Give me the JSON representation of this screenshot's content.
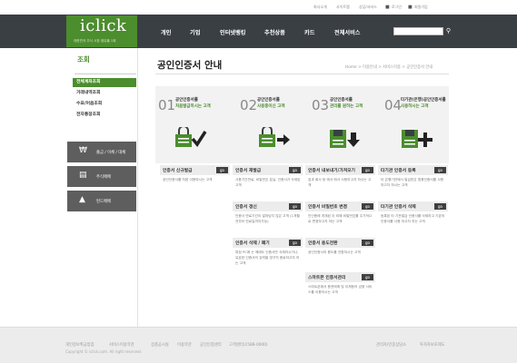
{
  "util_links": [
    "회사소개",
    "사이트맵",
    "상담/서비스",
    "로그인",
    "회원가입"
  ],
  "logo": {
    "name": "iclick",
    "tagline": "대한민국 주식 시장 점유율 1위"
  },
  "nav": [
    "개인",
    "기업",
    "인터넷뱅킹",
    "추천상품",
    "카드",
    "전체서비스"
  ],
  "sidebar": {
    "title": "조회",
    "items": [
      "전체계좌조회",
      "거래내역조회",
      "수표/어음조회",
      "전자통장조회"
    ],
    "quick": [
      {
        "icon": "coin-icon",
        "label": "출금 / 이체 / 대체"
      },
      {
        "icon": "chart-icon",
        "label": "주식매매"
      },
      {
        "icon": "bag-icon",
        "label": "펀드매매"
      }
    ]
  },
  "main": {
    "title": "공인인증서 안내",
    "breadcrumb": "Home > 이용안내 > 서비스이용 > 공인인증서 안내"
  },
  "steps": [
    {
      "num": "01",
      "line1": "공인인증서를",
      "line2": "처음발급하시는 고객",
      "icon": "certificate-check-icon"
    },
    {
      "num": "02",
      "line1": "공인인증서를",
      "line2": "사용중이신 고객",
      "icon": "certificate-export-icon"
    },
    {
      "num": "03",
      "line1": "공인인증서를",
      "line2": "관리를 원하는 고객",
      "icon": "certificate-download-icon"
    },
    {
      "num": "04",
      "line1": "타기관(은행)공인인증서를",
      "line2": "사용하시는 고객",
      "icon": "certificate-add-icon"
    }
  ],
  "cards": [
    [
      {
        "title": "인증서 신규발급",
        "desc": "공인인증서를 처음 이용하시는 고객"
      }
    ],
    [
      {
        "title": "인증서 재발급",
        "desc": "사용기간만료, 비밀번호 분실, 인증서가 삭제된 고객"
      },
      {
        "title": "인증서 갱신",
        "desc": "인증서 만료기간이 얼마남지 않은 고객 (1개월전부터 만료일까지가능)"
      },
      {
        "title": "인증서 삭제 / 폐기",
        "desc": "특정 PC에 는 예에도 인증서만 삭제하시거나, 유효한 인증서의 효력을 영구히 종료하고자 하는 고객"
      }
    ],
    [
      {
        "title": "인증서 내보내기/가져오기",
        "desc": "집과 회사 등 에서 에서 사용하고자 하시는 고객"
      },
      {
        "title": "인증서 비밀번호 변경",
        "desc": "인인증에 개재된 이 외에 비밀번호를 주기적으로 변경하고자 하는 고객"
      },
      {
        "title": "인증서 용도전환",
        "desc": "공인인증서의 용도를 전환하시는 고객"
      },
      {
        "title": "스마트폰 인증서관리",
        "desc": "스마트폰에서 증권매매 및 이체등의 금융 서비스를 이용하시는 고객"
      }
    ],
    [
      {
        "title": "타기관 인증서 등록",
        "desc": "타 은행기관에서 발급받은 범용인증서를 사용하고자 하시는 고객"
      },
      {
        "title": "타기관 인증서 삭제",
        "desc": "등록된 타 기관발급 인증서를 삭제하고 기존의 인증서를 사용 하고자 하는 고객"
      }
    ]
  ],
  "go_label": "go",
  "footer": {
    "links": [
      "개인정보취급방침",
      "서비스이용약관",
      "상품공시실",
      "이용약관",
      "공인인증센터",
      "고객센터(1588-0000)",
      "관리자/인증상담소",
      "투자자보호제도"
    ],
    "copyright": "Copyright © iclick.com. All right reserved."
  }
}
